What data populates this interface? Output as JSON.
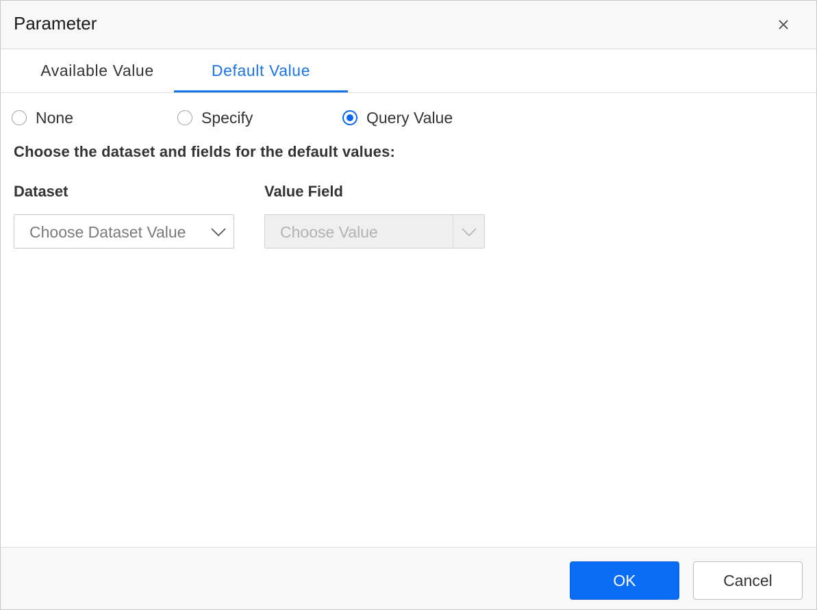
{
  "dialog": {
    "title": "Parameter",
    "close_icon": "close-icon"
  },
  "tabs": [
    {
      "label": "Available Value",
      "active": false
    },
    {
      "label": "Default Value",
      "active": true
    }
  ],
  "radio_options": [
    {
      "label": "None",
      "checked": false
    },
    {
      "label": "Specify",
      "checked": false
    },
    {
      "label": "Query Value",
      "checked": true
    }
  ],
  "instruction": "Choose the dataset and fields for the default values:",
  "fields": {
    "dataset": {
      "label": "Dataset",
      "placeholder": "Choose Dataset Value",
      "disabled": false
    },
    "value_field": {
      "label": "Value Field",
      "placeholder": "Choose Value",
      "disabled": true
    }
  },
  "footer": {
    "ok_label": "OK",
    "cancel_label": "Cancel"
  },
  "colors": {
    "accent": "#0a66f0",
    "active_tab": "#1a73e8",
    "primary_button": "#0a6cf5"
  }
}
